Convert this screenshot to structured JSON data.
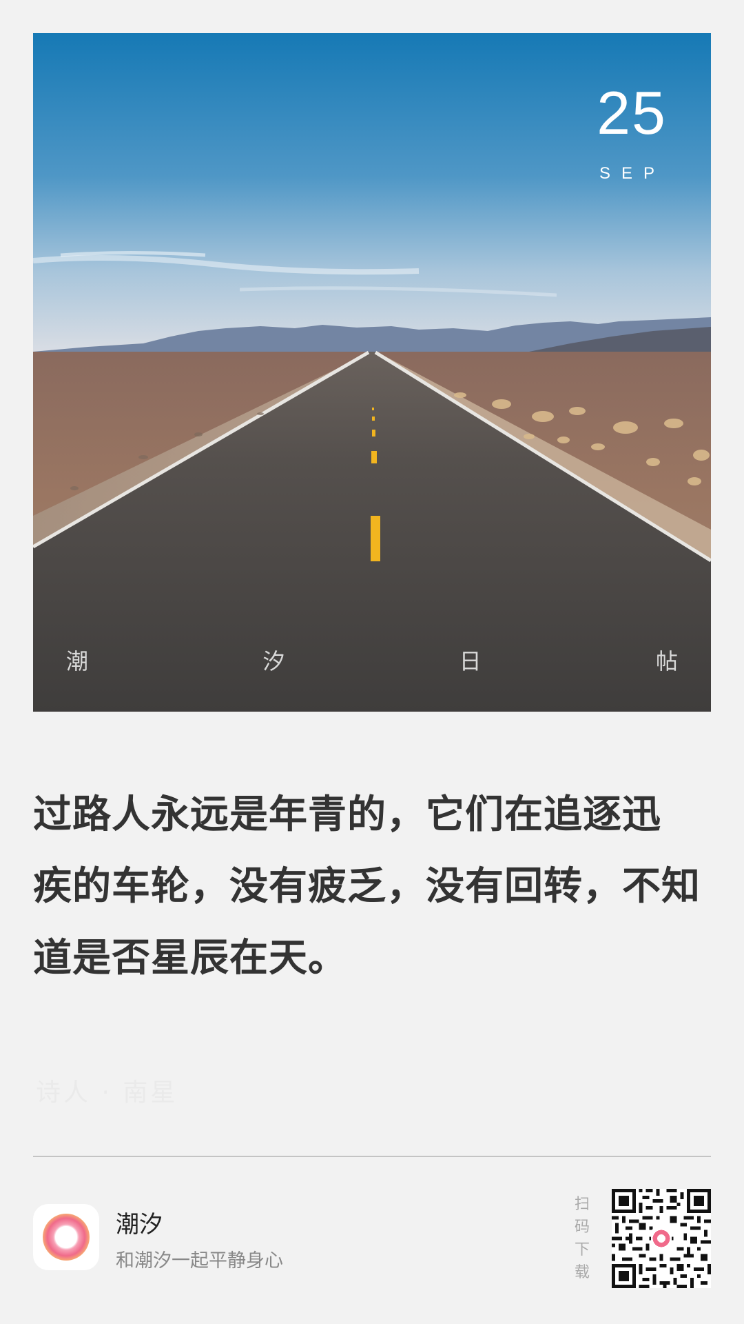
{
  "card": {
    "date": {
      "day": "25",
      "month": "SEP"
    },
    "brand_chars": [
      "潮",
      "汐",
      "日",
      "帖"
    ]
  },
  "quote": {
    "lines": [
      "过路人永远是年青的，它们在追逐迅",
      "疾的车轮，没有疲乏，没有回转，不知",
      "道是否星辰在天。"
    ],
    "author": "诗人 · 南星"
  },
  "footer": {
    "app_name": "潮汐",
    "slogan": "和潮汐一起平静身心",
    "scan_chars": [
      "扫",
      "码",
      "下",
      "载"
    ]
  },
  "icons": {
    "logo": "tide-app-logo-icon",
    "qr": "qr-code-icon"
  },
  "colors": {
    "background": "#f2f2f2",
    "quote_text": "#333333",
    "logo_pink": "#f06a8a",
    "logo_orange": "#f7a873"
  }
}
